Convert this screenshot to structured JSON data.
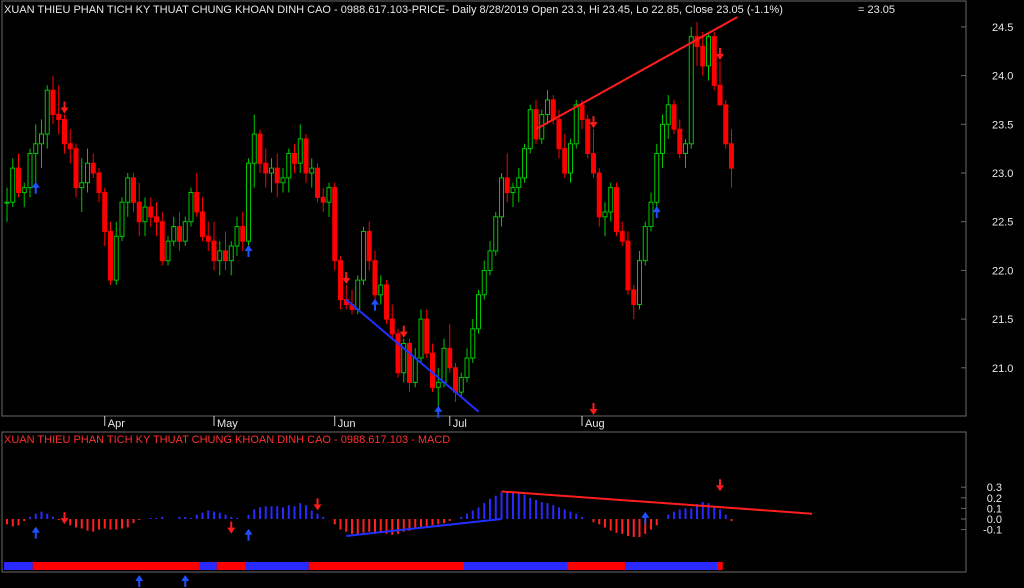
{
  "header": {
    "price_title": "XUAN THIEU PHAN TICH KY THUAT CHUNG KHOAN DINH CAO - 0988.617.103-PRICE- Daily 8/28/2019 Open 23.3, Hi 23.45, Lo 22.85, Close 23.05 (-1.1%)",
    "last_value": "= 23.05",
    "macd_title": "XUAN THIEU PHAN TICH KY THUAT CHUNG KHOAN DINH CAO - 0988.617.103 - MACD"
  },
  "colors": {
    "up": "#00c800",
    "down": "#ff0000",
    "macd_pos": "#2a2aff",
    "macd_neg": "#ff2020",
    "trendline_red": "#ff1e1e",
    "trendline_blue": "#2030ff",
    "arrow_red": "#ff1a1a",
    "arrow_blue": "#1e50ff",
    "grid": "#6a6a6a",
    "text": "#e8e8e8"
  },
  "chart_data": [
    {
      "type": "candlestick",
      "title": "XUAN THIEU PHAN TICH KY THUAT CHUNG KHOAN DINH CAO - 0988.617.103-PRICE- Daily 8/28/2019",
      "ylim": [
        20.55,
        24.65
      ],
      "y_ticks": [
        "24.5",
        "24.0",
        "23.5",
        "23.0",
        "22.5",
        "22.0",
        "21.5",
        "21.0"
      ],
      "x_ticks": [
        "Apr",
        "May",
        "Jun",
        "Jul",
        "Aug"
      ],
      "x_tick_index": [
        17,
        36,
        57,
        77,
        100
      ],
      "ohlc": [
        [
          22.7,
          22.85,
          22.5,
          22.7
        ],
        [
          22.7,
          23.15,
          22.65,
          23.05
        ],
        [
          23.05,
          23.2,
          22.75,
          22.8
        ],
        [
          22.8,
          22.9,
          22.65,
          22.85
        ],
        [
          22.85,
          23.25,
          22.75,
          23.2
        ],
        [
          23.2,
          23.5,
          22.9,
          23.3
        ],
        [
          23.3,
          23.55,
          23.05,
          23.4
        ],
        [
          23.4,
          23.9,
          23.25,
          23.85
        ],
        [
          23.85,
          24.0,
          23.5,
          23.6
        ],
        [
          23.6,
          23.9,
          23.4,
          23.55
        ],
        [
          23.55,
          23.6,
          23.2,
          23.3
        ],
        [
          23.3,
          23.45,
          23.1,
          23.25
        ],
        [
          23.25,
          23.3,
          22.75,
          22.85
        ],
        [
          22.85,
          23.15,
          22.6,
          22.9
        ],
        [
          22.9,
          23.25,
          22.8,
          23.1
        ],
        [
          23.1,
          23.2,
          22.95,
          23.0
        ],
        [
          23.0,
          23.05,
          22.7,
          22.8
        ],
        [
          22.8,
          22.85,
          22.25,
          22.4
        ],
        [
          22.4,
          22.5,
          21.85,
          21.9
        ],
        [
          21.9,
          22.5,
          21.85,
          22.35
        ],
        [
          22.35,
          22.75,
          22.3,
          22.7
        ],
        [
          22.7,
          23.0,
          22.55,
          22.95
        ],
        [
          22.95,
          23.0,
          22.6,
          22.7
        ],
        [
          22.7,
          22.9,
          22.35,
          22.5
        ],
        [
          22.5,
          22.75,
          22.35,
          22.65
        ],
        [
          22.65,
          22.75,
          22.45,
          22.55
        ],
        [
          22.55,
          22.7,
          22.35,
          22.5
        ],
        [
          22.5,
          22.6,
          22.05,
          22.1
        ],
        [
          22.1,
          22.35,
          22.05,
          22.3
        ],
        [
          22.3,
          22.55,
          22.25,
          22.45
        ],
        [
          22.45,
          22.6,
          22.2,
          22.3
        ],
        [
          22.3,
          22.55,
          22.25,
          22.5
        ],
        [
          22.5,
          22.85,
          22.45,
          22.8
        ],
        [
          22.8,
          23.0,
          22.55,
          22.6
        ],
        [
          22.6,
          22.75,
          22.3,
          22.35
        ],
        [
          22.35,
          22.5,
          22.2,
          22.3
        ],
        [
          22.3,
          22.5,
          22.0,
          22.1
        ],
        [
          22.1,
          22.3,
          21.95,
          22.2
        ],
        [
          22.2,
          22.4,
          22.0,
          22.1
        ],
        [
          22.1,
          22.3,
          21.95,
          22.25
        ],
        [
          22.25,
          22.55,
          22.15,
          22.45
        ],
        [
          22.45,
          22.6,
          22.2,
          22.3
        ],
        [
          22.3,
          23.15,
          22.25,
          23.1
        ],
        [
          23.1,
          23.6,
          22.85,
          23.4
        ],
        [
          23.4,
          23.45,
          23.0,
          23.1
        ],
        [
          23.1,
          23.25,
          22.85,
          23.0
        ],
        [
          23.0,
          23.15,
          22.8,
          23.05
        ],
        [
          23.05,
          23.2,
          22.75,
          22.9
        ],
        [
          22.9,
          23.05,
          22.8,
          22.95
        ],
        [
          22.95,
          23.25,
          22.8,
          23.2
        ],
        [
          23.2,
          23.3,
          23.0,
          23.1
        ],
        [
          23.1,
          23.5,
          23.0,
          23.35
        ],
        [
          23.35,
          23.4,
          22.9,
          23.0
        ],
        [
          23.0,
          23.15,
          22.85,
          23.05
        ],
        [
          23.05,
          23.1,
          22.7,
          22.75
        ],
        [
          22.75,
          22.85,
          22.6,
          22.7
        ],
        [
          22.7,
          22.9,
          22.55,
          22.85
        ],
        [
          22.85,
          22.9,
          22.0,
          22.1
        ],
        [
          22.1,
          22.15,
          21.6,
          21.7
        ],
        [
          21.7,
          21.85,
          21.6,
          21.65
        ],
        [
          21.65,
          21.8,
          21.55,
          21.6
        ],
        [
          21.6,
          21.95,
          21.55,
          21.9
        ],
        [
          21.9,
          22.45,
          21.85,
          22.4
        ],
        [
          22.4,
          22.5,
          22.0,
          22.1
        ],
        [
          22.1,
          22.2,
          21.7,
          21.75
        ],
        [
          21.75,
          21.95,
          21.65,
          21.85
        ],
        [
          21.85,
          21.9,
          21.45,
          21.5
        ],
        [
          21.5,
          21.65,
          21.3,
          21.35
        ],
        [
          21.35,
          21.4,
          20.9,
          20.95
        ],
        [
          20.95,
          21.3,
          20.85,
          21.25
        ],
        [
          21.25,
          21.3,
          20.75,
          20.85
        ],
        [
          20.85,
          21.2,
          20.8,
          21.1
        ],
        [
          21.1,
          21.6,
          21.05,
          21.5
        ],
        [
          21.5,
          21.6,
          21.1,
          21.15
        ],
        [
          21.15,
          21.25,
          20.75,
          20.8
        ],
        [
          20.8,
          21.0,
          20.6,
          20.85
        ],
        [
          20.85,
          21.3,
          20.8,
          21.2
        ],
        [
          21.2,
          21.45,
          20.95,
          21.0
        ],
        [
          21.0,
          21.05,
          20.65,
          20.75
        ],
        [
          20.75,
          20.95,
          20.7,
          20.9
        ],
        [
          20.9,
          21.2,
          20.85,
          21.1
        ],
        [
          21.1,
          21.5,
          21.05,
          21.4
        ],
        [
          21.4,
          21.8,
          21.35,
          21.75
        ],
        [
          21.75,
          22.1,
          21.7,
          22.0
        ],
        [
          22.0,
          22.3,
          21.95,
          22.2
        ],
        [
          22.2,
          22.6,
          22.15,
          22.55
        ],
        [
          22.55,
          23.0,
          22.45,
          22.95
        ],
        [
          22.95,
          23.2,
          22.7,
          22.8
        ],
        [
          22.8,
          22.9,
          22.65,
          22.85
        ],
        [
          22.85,
          23.05,
          22.7,
          22.95
        ],
        [
          22.95,
          23.3,
          22.9,
          23.25
        ],
        [
          23.25,
          23.7,
          23.2,
          23.65
        ],
        [
          23.65,
          23.75,
          23.3,
          23.35
        ],
        [
          23.35,
          23.65,
          23.3,
          23.6
        ],
        [
          23.6,
          23.85,
          23.5,
          23.75
        ],
        [
          23.75,
          23.8,
          23.5,
          23.55
        ],
        [
          23.55,
          23.65,
          23.15,
          23.25
        ],
        [
          23.25,
          23.4,
          22.95,
          23.0
        ],
        [
          23.0,
          23.35,
          22.9,
          23.3
        ],
        [
          23.3,
          23.75,
          23.25,
          23.7
        ],
        [
          23.7,
          23.75,
          23.45,
          23.55
        ],
        [
          23.55,
          23.6,
          23.15,
          23.2
        ],
        [
          23.2,
          23.45,
          22.95,
          23.0
        ],
        [
          23.0,
          23.05,
          22.45,
          22.55
        ],
        [
          22.55,
          22.7,
          22.35,
          22.6
        ],
        [
          22.6,
          22.9,
          22.5,
          22.85
        ],
        [
          22.85,
          22.9,
          22.35,
          22.4
        ],
        [
          22.4,
          22.5,
          22.25,
          22.3
        ],
        [
          22.3,
          22.4,
          21.75,
          21.8
        ],
        [
          21.8,
          21.85,
          21.5,
          21.65
        ],
        [
          21.65,
          22.2,
          21.6,
          22.1
        ],
        [
          22.1,
          22.5,
          22.05,
          22.45
        ],
        [
          22.45,
          22.8,
          22.4,
          22.7
        ],
        [
          22.7,
          23.3,
          22.65,
          23.2
        ],
        [
          23.2,
          23.6,
          23.05,
          23.5
        ],
        [
          23.5,
          23.8,
          23.35,
          23.7
        ],
        [
          23.7,
          23.75,
          23.4,
          23.45
        ],
        [
          23.45,
          23.55,
          23.15,
          23.2
        ],
        [
          23.2,
          23.35,
          23.05,
          23.3
        ],
        [
          23.3,
          24.5,
          23.25,
          24.4
        ],
        [
          24.4,
          24.55,
          24.1,
          24.3
        ],
        [
          24.3,
          24.45,
          24.0,
          24.1
        ],
        [
          24.1,
          24.45,
          23.95,
          24.4
        ],
        [
          24.4,
          24.45,
          23.85,
          23.9
        ],
        [
          23.9,
          24.15,
          23.7,
          23.7
        ],
        [
          23.7,
          23.75,
          23.25,
          23.3
        ],
        [
          23.3,
          23.45,
          22.85,
          23.05
        ]
      ],
      "annotations": [
        {
          "type": "trendline",
          "color": "red",
          "from": [
            92,
            23.45
          ],
          "to": [
            127,
            24.6
          ]
        },
        {
          "type": "trendline",
          "color": "blue",
          "from": [
            59,
            21.7
          ],
          "to": [
            82,
            20.55
          ]
        }
      ],
      "signals": [
        {
          "index": 5,
          "dir": "up",
          "color": "blue"
        },
        {
          "index": 10,
          "dir": "down",
          "color": "red"
        },
        {
          "index": 42,
          "dir": "up",
          "color": "blue"
        },
        {
          "index": 59,
          "dir": "down",
          "color": "red"
        },
        {
          "index": 64,
          "dir": "up",
          "color": "blue"
        },
        {
          "index": 69,
          "dir": "down",
          "color": "red"
        },
        {
          "index": 75,
          "dir": "up",
          "color": "blue"
        },
        {
          "index": 102,
          "dir": "down",
          "color": "red"
        },
        {
          "index": 113,
          "dir": "up",
          "color": "blue"
        },
        {
          "index": 124,
          "dir": "down",
          "color": "red"
        }
      ]
    },
    {
      "type": "bar",
      "title": "XUAN THIEU PHAN TICH KY THUAT CHUNG KHOAN DINH CAO - 0988.617.103 - MACD",
      "ylim": [
        -0.2,
        0.35
      ],
      "y_ticks": [
        "0.3",
        "0.2",
        "0.1",
        "0.0",
        "-0.1"
      ],
      "values": [
        -0.05,
        -0.07,
        -0.06,
        -0.02,
        0.02,
        0.05,
        0.07,
        0.05,
        0.02,
        -0.01,
        -0.04,
        -0.06,
        -0.08,
        -0.09,
        -0.11,
        -0.12,
        -0.1,
        -0.09,
        -0.1,
        -0.1,
        -0.09,
        -0.08,
        -0.04,
        -0.01,
        0.0,
        0.01,
        0.01,
        0.02,
        0.0,
        0.0,
        0.02,
        0.02,
        0.01,
        0.04,
        0.06,
        0.08,
        0.07,
        0.06,
        0.04,
        0.02,
        0.01,
        0.0,
        0.04,
        0.09,
        0.11,
        0.12,
        0.12,
        0.12,
        0.11,
        0.13,
        0.12,
        0.15,
        0.13,
        0.08,
        0.05,
        0.02,
        0.0,
        -0.05,
        -0.1,
        -0.12,
        -0.14,
        -0.15,
        -0.13,
        -0.12,
        -0.14,
        -0.13,
        -0.14,
        -0.15,
        -0.14,
        -0.12,
        -0.11,
        -0.09,
        -0.09,
        -0.08,
        -0.06,
        -0.05,
        -0.04,
        -0.02,
        0.0,
        0.02,
        0.05,
        0.08,
        0.11,
        0.15,
        0.19,
        0.22,
        0.25,
        0.26,
        0.25,
        0.24,
        0.23,
        0.2,
        0.18,
        0.16,
        0.15,
        0.13,
        0.11,
        0.09,
        0.07,
        0.05,
        0.02,
        0.0,
        -0.03,
        -0.05,
        -0.08,
        -0.11,
        -0.13,
        -0.14,
        -0.16,
        -0.17,
        -0.17,
        -0.14,
        -0.1,
        -0.06,
        0.0,
        0.04,
        0.07,
        0.09,
        0.1,
        0.1,
        0.14,
        0.16,
        0.15,
        0.12,
        0.09,
        0.04,
        -0.02
      ],
      "annotations": [
        {
          "type": "trendline",
          "color": "red",
          "from": [
            86,
            0.26
          ],
          "to": [
            140,
            0.05
          ]
        },
        {
          "type": "trendline",
          "color": "blue",
          "from": [
            59,
            -0.16
          ],
          "to": [
            86,
            0.0
          ]
        }
      ],
      "signals": [
        {
          "index": 5,
          "dir": "up",
          "color": "blue",
          "y": -0.1
        },
        {
          "index": 10,
          "dir": "down",
          "color": "red",
          "y": -0.02
        },
        {
          "index": 39,
          "dir": "down",
          "color": "red",
          "y": -0.11
        },
        {
          "index": 42,
          "dir": "up",
          "color": "blue",
          "y": -0.12
        },
        {
          "index": 54,
          "dir": "down",
          "color": "red",
          "y": 0.11
        },
        {
          "index": 111,
          "dir": "up",
          "color": "blue",
          "y": 0.04
        },
        {
          "index": 124,
          "dir": "down",
          "color": "red",
          "y": 0.29
        }
      ],
      "bottom_arrows": [
        {
          "index": 23,
          "dir": "up",
          "color": "blue"
        },
        {
          "index": 31,
          "dir": "up",
          "color": "blue"
        }
      ]
    }
  ],
  "status_strip": [
    {
      "from": 0,
      "to": 5,
      "color": "blue"
    },
    {
      "from": 5,
      "to": 10,
      "color": "red"
    },
    {
      "from": 10,
      "to": 34,
      "color": "red"
    },
    {
      "from": 34,
      "to": 37,
      "color": "blue"
    },
    {
      "from": 37,
      "to": 42,
      "color": "red"
    },
    {
      "from": 42,
      "to": 53,
      "color": "blue"
    },
    {
      "from": 53,
      "to": 80,
      "color": "red"
    },
    {
      "from": 80,
      "to": 98,
      "color": "blue"
    },
    {
      "from": 98,
      "to": 108,
      "color": "red"
    },
    {
      "from": 108,
      "to": 124,
      "color": "blue"
    },
    {
      "from": 124,
      "to": 125,
      "color": "red"
    }
  ]
}
